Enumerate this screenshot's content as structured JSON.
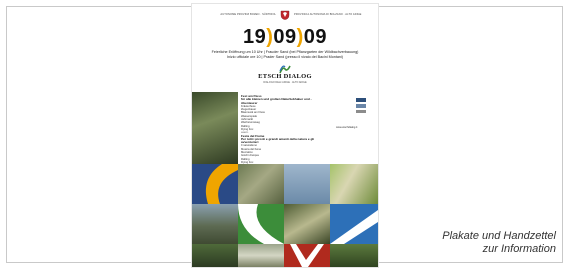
{
  "poster": {
    "top_left": "AUTONOME PROVINZ BOZEN · SÜDTIROL",
    "top_right": "PROVINCIA AUTONOMA DI BOLZANO · ALTO ADIGE",
    "date_day": "19",
    "date_month": "09",
    "date_year": "09",
    "date_sep": ")",
    "subtitle_line1": "Feierliche Eröffnung um 10 Uhr | Frauder Sand (bei Pflanzgarten der Wildbachverbauung)",
    "subtitle_line2": "Inizio ufficiale ore 10 | Prader Sand (presso il vivaio dei Bacini Montani)",
    "logo_word": "ETSCH DIALOG",
    "logo_sub": "DIALOGO DELL'ADIGE · ALTO ADIGE",
    "fest_title_de": "Fest am Fluss",
    "fest_sub_de": "für alle kleinen und großen Naturliebhaber und -Abenteurer",
    "items_de": [
      "Kräuterhexe",
      "Ziegenbauer",
      "Blasmusik am Fluss",
      "Wasserspiele",
      "Jahrmarkt",
      "Wachstumsweg",
      "Rafting",
      "Flying Fox",
      "u.a.m."
    ],
    "fest_title_it": "Festa del Fiume",
    "fest_sub_it": "Per tutti i piccoli e grandi amanti della natura e gli avventurieri",
    "items_it": [
      "Il naturalismo",
      "Musica del fiume",
      "Mercatino",
      "Giochi d'acqua",
      "Rafting",
      "Flying Fox",
      "e molto altro ancora"
    ],
    "url": "www.etschdialog.it"
  },
  "caption": {
    "line1": "Plakate und Handzettel",
    "line2": "zur Information"
  },
  "colors": {
    "accent": "#f0a500",
    "crest_red": "#c0272d",
    "green": "#3c8d3a",
    "blue": "#2d70b8"
  }
}
